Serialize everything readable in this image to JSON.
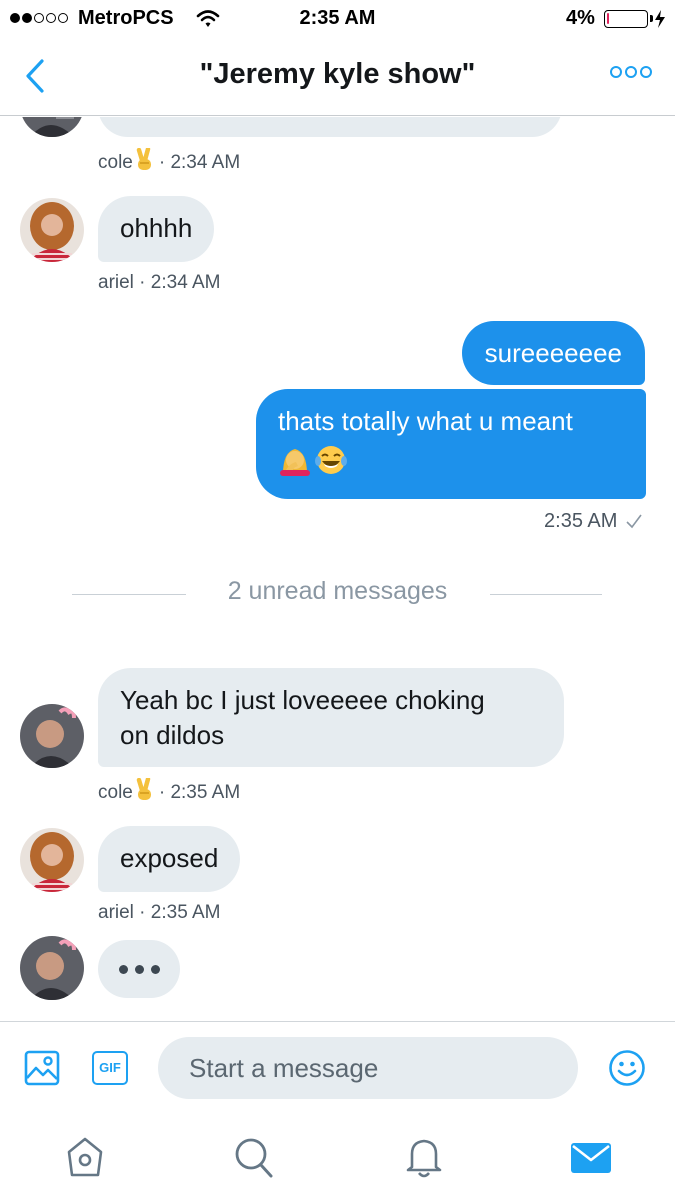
{
  "status_bar": {
    "carrier": "MetroPCS",
    "time": "2:35 AM",
    "battery_percent": "4%",
    "battery_level": 0.04,
    "battery_color": "#e0245e"
  },
  "header": {
    "title": "\"Jeremy  kyle show\"",
    "back_icon": "chevron-left-icon",
    "more_icon": "more-dots-icon",
    "accent": "#1da1f2"
  },
  "messages": [
    {
      "sender": "cole",
      "side": "incoming",
      "text": "",
      "truncated": true,
      "meta_name": "cole",
      "meta_emoji": "victory-hand-emoji",
      "meta_time": "· 2:34 AM"
    },
    {
      "sender": "ariel",
      "side": "incoming",
      "text": "ohhhh",
      "meta_text": "ariel · 2:34 AM"
    },
    {
      "side": "outgoing",
      "text": "sureeeeeee"
    },
    {
      "side": "outgoing",
      "text": "thats totally what u meant",
      "emojis": [
        "face-palm-emoji",
        "tears-of-joy-emoji"
      ],
      "meta_text": "2:35 AM",
      "meta_icon": "check-icon"
    },
    {
      "sender": "cole",
      "side": "incoming",
      "lines": [
        "Yeah bc I just loveeeee choking",
        "on dildos"
      ],
      "meta_name": "cole",
      "meta_emoji": "victory-hand-emoji",
      "meta_time": "· 2:35 AM"
    },
    {
      "sender": "ariel",
      "side": "incoming",
      "text": "exposed",
      "meta_text": "ariel · 2:35 AM"
    },
    {
      "sender": "cole",
      "side": "incoming",
      "typing": true
    }
  ],
  "unread_divider": "2 unread messages",
  "composer": {
    "placeholder": "Start a message",
    "gif_label": "GIF",
    "media_icon": "image-icon",
    "emoji_icon": "smiley-icon"
  },
  "tabbar": {
    "items": [
      "home-icon",
      "search-icon",
      "notifications-bell-icon",
      "messages-envelope-icon"
    ],
    "active": "messages-envelope-icon"
  },
  "colors": {
    "outgoing_bubble": "#1d91eb",
    "incoming_bubble": "#e6ecf0",
    "accent": "#1da1f2"
  }
}
